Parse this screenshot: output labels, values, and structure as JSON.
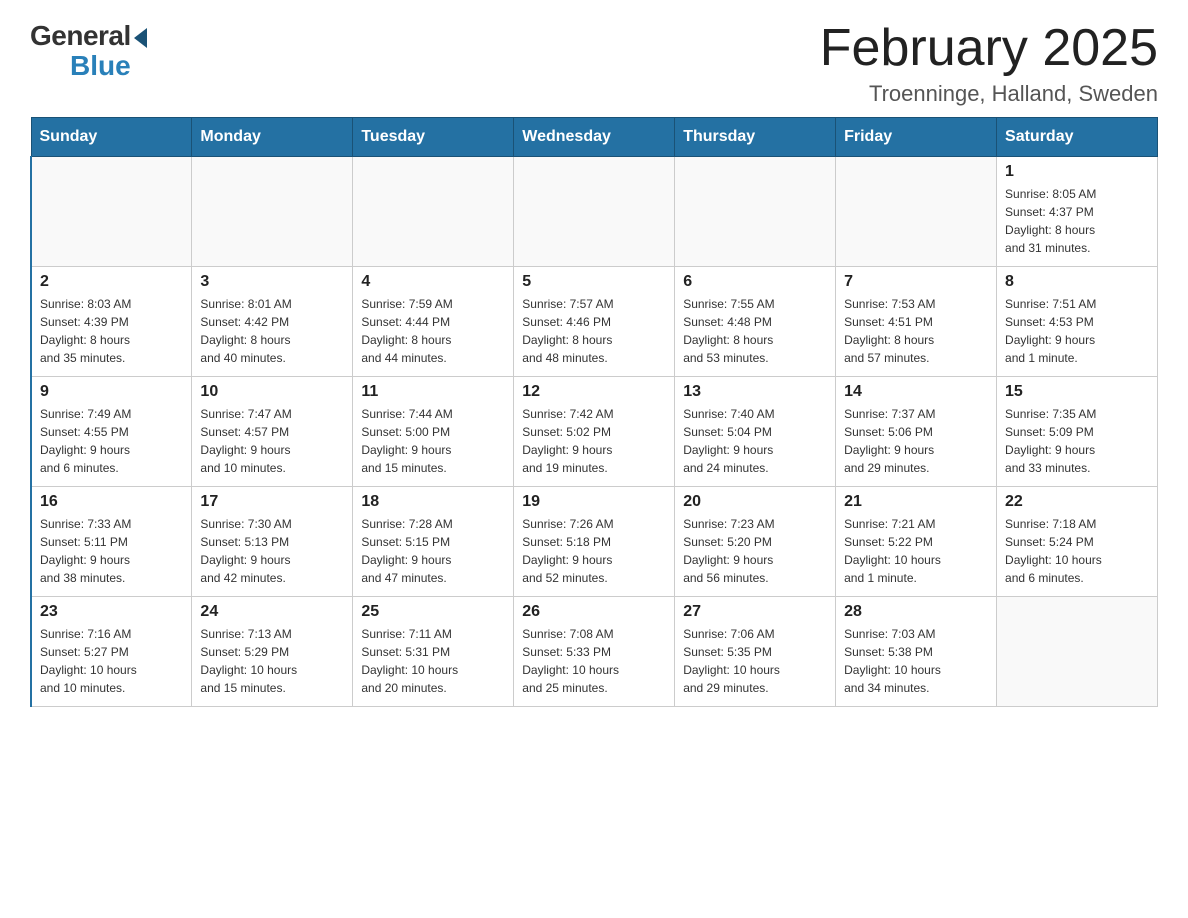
{
  "header": {
    "logo_general": "General",
    "logo_blue": "Blue",
    "month_title": "February 2025",
    "location": "Troenninge, Halland, Sweden"
  },
  "days_of_week": [
    "Sunday",
    "Monday",
    "Tuesday",
    "Wednesday",
    "Thursday",
    "Friday",
    "Saturday"
  ],
  "weeks": [
    [
      {
        "day": "",
        "info": ""
      },
      {
        "day": "",
        "info": ""
      },
      {
        "day": "",
        "info": ""
      },
      {
        "day": "",
        "info": ""
      },
      {
        "day": "",
        "info": ""
      },
      {
        "day": "",
        "info": ""
      },
      {
        "day": "1",
        "info": "Sunrise: 8:05 AM\nSunset: 4:37 PM\nDaylight: 8 hours\nand 31 minutes."
      }
    ],
    [
      {
        "day": "2",
        "info": "Sunrise: 8:03 AM\nSunset: 4:39 PM\nDaylight: 8 hours\nand 35 minutes."
      },
      {
        "day": "3",
        "info": "Sunrise: 8:01 AM\nSunset: 4:42 PM\nDaylight: 8 hours\nand 40 minutes."
      },
      {
        "day": "4",
        "info": "Sunrise: 7:59 AM\nSunset: 4:44 PM\nDaylight: 8 hours\nand 44 minutes."
      },
      {
        "day": "5",
        "info": "Sunrise: 7:57 AM\nSunset: 4:46 PM\nDaylight: 8 hours\nand 48 minutes."
      },
      {
        "day": "6",
        "info": "Sunrise: 7:55 AM\nSunset: 4:48 PM\nDaylight: 8 hours\nand 53 minutes."
      },
      {
        "day": "7",
        "info": "Sunrise: 7:53 AM\nSunset: 4:51 PM\nDaylight: 8 hours\nand 57 minutes."
      },
      {
        "day": "8",
        "info": "Sunrise: 7:51 AM\nSunset: 4:53 PM\nDaylight: 9 hours\nand 1 minute."
      }
    ],
    [
      {
        "day": "9",
        "info": "Sunrise: 7:49 AM\nSunset: 4:55 PM\nDaylight: 9 hours\nand 6 minutes."
      },
      {
        "day": "10",
        "info": "Sunrise: 7:47 AM\nSunset: 4:57 PM\nDaylight: 9 hours\nand 10 minutes."
      },
      {
        "day": "11",
        "info": "Sunrise: 7:44 AM\nSunset: 5:00 PM\nDaylight: 9 hours\nand 15 minutes."
      },
      {
        "day": "12",
        "info": "Sunrise: 7:42 AM\nSunset: 5:02 PM\nDaylight: 9 hours\nand 19 minutes."
      },
      {
        "day": "13",
        "info": "Sunrise: 7:40 AM\nSunset: 5:04 PM\nDaylight: 9 hours\nand 24 minutes."
      },
      {
        "day": "14",
        "info": "Sunrise: 7:37 AM\nSunset: 5:06 PM\nDaylight: 9 hours\nand 29 minutes."
      },
      {
        "day": "15",
        "info": "Sunrise: 7:35 AM\nSunset: 5:09 PM\nDaylight: 9 hours\nand 33 minutes."
      }
    ],
    [
      {
        "day": "16",
        "info": "Sunrise: 7:33 AM\nSunset: 5:11 PM\nDaylight: 9 hours\nand 38 minutes."
      },
      {
        "day": "17",
        "info": "Sunrise: 7:30 AM\nSunset: 5:13 PM\nDaylight: 9 hours\nand 42 minutes."
      },
      {
        "day": "18",
        "info": "Sunrise: 7:28 AM\nSunset: 5:15 PM\nDaylight: 9 hours\nand 47 minutes."
      },
      {
        "day": "19",
        "info": "Sunrise: 7:26 AM\nSunset: 5:18 PM\nDaylight: 9 hours\nand 52 minutes."
      },
      {
        "day": "20",
        "info": "Sunrise: 7:23 AM\nSunset: 5:20 PM\nDaylight: 9 hours\nand 56 minutes."
      },
      {
        "day": "21",
        "info": "Sunrise: 7:21 AM\nSunset: 5:22 PM\nDaylight: 10 hours\nand 1 minute."
      },
      {
        "day": "22",
        "info": "Sunrise: 7:18 AM\nSunset: 5:24 PM\nDaylight: 10 hours\nand 6 minutes."
      }
    ],
    [
      {
        "day": "23",
        "info": "Sunrise: 7:16 AM\nSunset: 5:27 PM\nDaylight: 10 hours\nand 10 minutes."
      },
      {
        "day": "24",
        "info": "Sunrise: 7:13 AM\nSunset: 5:29 PM\nDaylight: 10 hours\nand 15 minutes."
      },
      {
        "day": "25",
        "info": "Sunrise: 7:11 AM\nSunset: 5:31 PM\nDaylight: 10 hours\nand 20 minutes."
      },
      {
        "day": "26",
        "info": "Sunrise: 7:08 AM\nSunset: 5:33 PM\nDaylight: 10 hours\nand 25 minutes."
      },
      {
        "day": "27",
        "info": "Sunrise: 7:06 AM\nSunset: 5:35 PM\nDaylight: 10 hours\nand 29 minutes."
      },
      {
        "day": "28",
        "info": "Sunrise: 7:03 AM\nSunset: 5:38 PM\nDaylight: 10 hours\nand 34 minutes."
      },
      {
        "day": "",
        "info": ""
      }
    ]
  ]
}
